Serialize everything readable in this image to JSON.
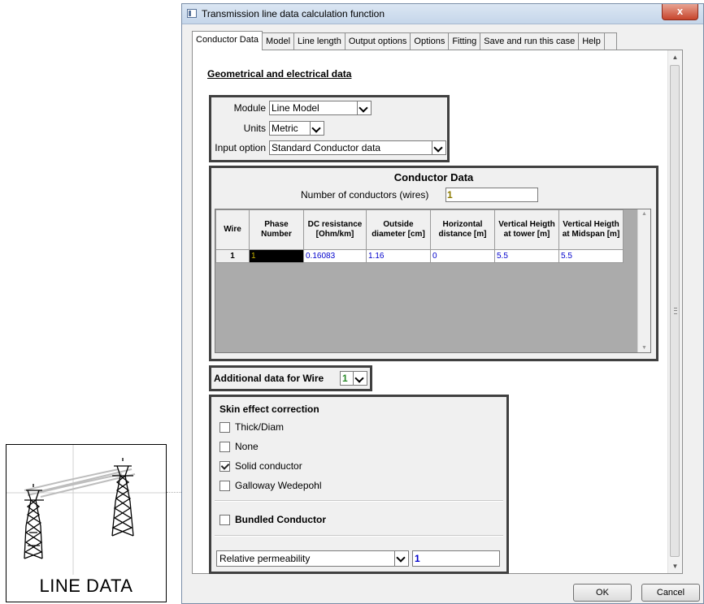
{
  "canvas_icon": {
    "label": "LINE DATA",
    "icon": "transmission-towers-icon"
  },
  "window": {
    "title": "Transmission line data calculation function",
    "close_glyph": "x"
  },
  "tabs": [
    {
      "label": "Conductor Data",
      "active": true
    },
    {
      "label": "Model"
    },
    {
      "label": "Line length"
    },
    {
      "label": "Output options"
    },
    {
      "label": "Options"
    },
    {
      "label": "Fitting"
    },
    {
      "label": "Save and run this case"
    },
    {
      "label": "Help"
    }
  ],
  "section_title": "Geometrical and electrical data",
  "settings": {
    "module_label": "Module",
    "module_value": "Line Model",
    "units_label": "Units",
    "units_value": "Metric",
    "input_option_label": "Input option",
    "input_option_value": "Standard Conductor data"
  },
  "conductor_data": {
    "title": "Conductor Data",
    "num_conductors_label": "Number of conductors (wires)",
    "num_conductors_value": "1",
    "columns": [
      "Wire",
      "Phase Number",
      "DC resistance [Ohm/km]",
      "Outside diameter [cm]",
      "Horizontal distance [m]",
      "Vertical Heigth at tower [m]",
      "Vertical Heigth at Midspan [m]"
    ],
    "rows": [
      [
        "1",
        "1",
        "0.16083",
        "1.16",
        "0",
        "5.5",
        "5.5"
      ]
    ]
  },
  "additional": {
    "label": "Additional data for Wire",
    "wire_value": "1"
  },
  "skin": {
    "title": "Skin effect correction",
    "options": [
      {
        "label": "Thick/Diam",
        "checked": false
      },
      {
        "label": "None",
        "checked": false
      },
      {
        "label": "Solid conductor",
        "checked": true
      },
      {
        "label": "Galloway Wedepohl",
        "checked": false
      }
    ],
    "bundled_label": "Bundled Conductor",
    "bundled_checked": false,
    "permeability_option": "Relative permeability",
    "permeability_value": "1"
  },
  "buttons": {
    "ok": "OK",
    "cancel": "Cancel"
  }
}
